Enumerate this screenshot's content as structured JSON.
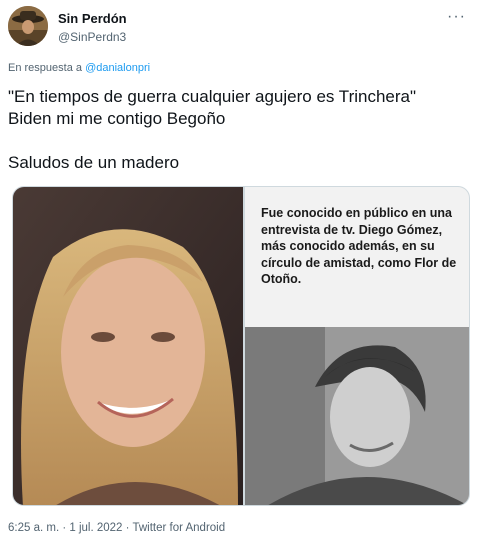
{
  "author": {
    "display_name": "Sin Perdón",
    "handle": "@SinPerdn3"
  },
  "menu": {
    "more_label": "···"
  },
  "reply_context": {
    "prefix": "En respuesta a",
    "mention": "@danialonpri"
  },
  "tweet": {
    "line1": "\"En tiempos de guerra cualquier agujero es Trinchera\"",
    "line2": "Biden mi me contigo Begoño",
    "line3": "Saludos de un madero"
  },
  "media": {
    "caption": "Fue conocido en público en una entrevista de tv. Diego Gómez, más conocido además, en su círculo de amistad, como Flor de Otoño."
  },
  "meta": {
    "timestamp": "6:25 a. m. · 1 jul. 2022 · Twitter for Android"
  }
}
